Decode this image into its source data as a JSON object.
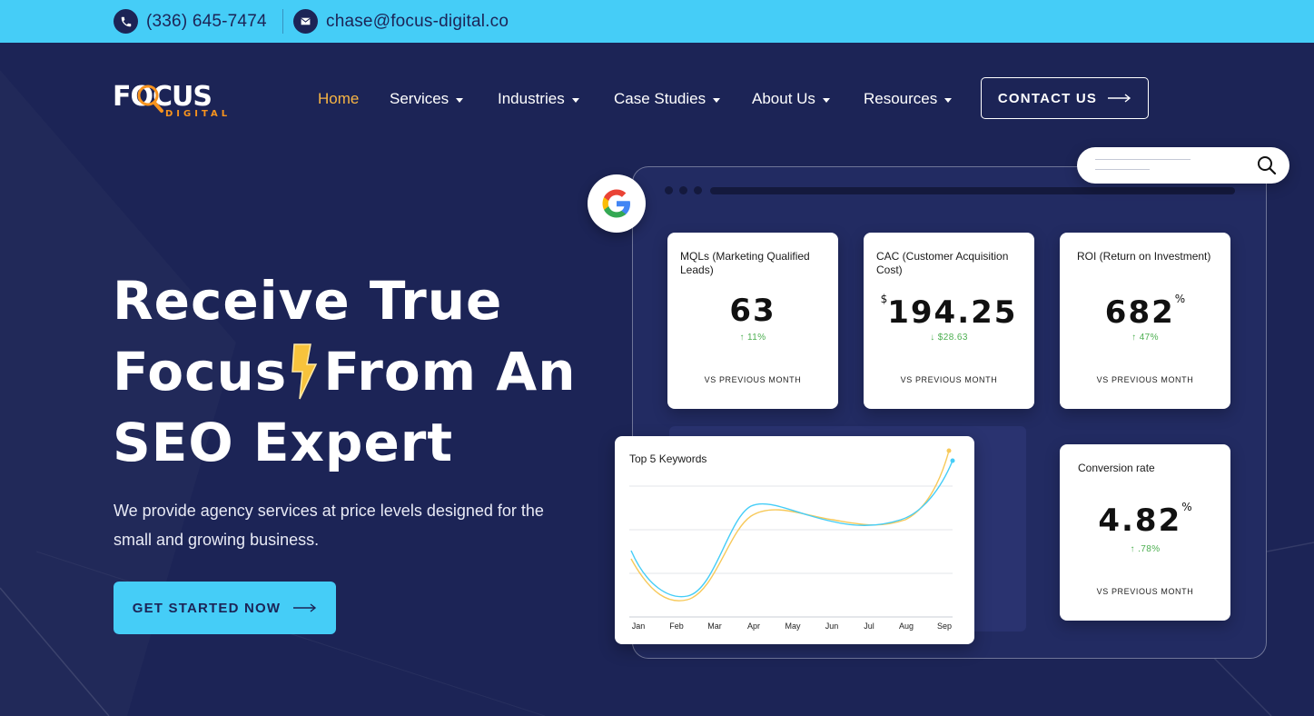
{
  "topbar": {
    "phone": "(336) 645-7474",
    "email": "chase@focus-digital.co",
    "phone_icon": "phone-icon",
    "email_icon": "mail-icon",
    "bg_color": "#45cdf7"
  },
  "brand": {
    "logo_word": "FOCUS",
    "logo_sub": "DIGITAL",
    "accent": "#f7931e"
  },
  "nav": {
    "items": [
      {
        "label": "Home",
        "active": true,
        "dropdown": false
      },
      {
        "label": "Services",
        "active": false,
        "dropdown": true
      },
      {
        "label": "Industries",
        "active": false,
        "dropdown": true
      },
      {
        "label": "Case Studies",
        "active": false,
        "dropdown": true
      },
      {
        "label": "About Us",
        "active": false,
        "dropdown": true
      },
      {
        "label": "Resources",
        "active": false,
        "dropdown": true
      }
    ],
    "contact_label": "CONTACT US",
    "active_color": "#f7b544"
  },
  "hero": {
    "line1": "Receive True",
    "line2a": "Focus",
    "line2b": "From An",
    "line3": "SEO Expert",
    "subtitle": "We provide agency services at price levels designed for the small and growing business.",
    "cta_label": "GET STARTED NOW",
    "bg_color": "#1c2456"
  },
  "dashboard": {
    "cards": [
      {
        "title": "MQLs (Marketing Qualified Leads)",
        "prefix": "",
        "value": "63",
        "suffix": "",
        "delta": "11%",
        "direction": "up",
        "footer": "VS PREVIOUS MONTH"
      },
      {
        "title": "CAC (Customer Acquisition Cost)",
        "prefix": "$",
        "value": "194.25",
        "suffix": "",
        "delta": "$28.63",
        "direction": "down",
        "footer": "VS PREVIOUS MONTH"
      },
      {
        "title": "ROI (Return on Investment)",
        "prefix": "",
        "value": "682",
        "suffix": "%",
        "delta": "47%",
        "direction": "up",
        "footer": "VS PREVIOUS MONTH"
      },
      {
        "title": "Conversion rate",
        "prefix": "",
        "value": "4.82",
        "suffix": "%",
        "delta": ".78%",
        "direction": "up",
        "footer": "VS PREVIOUS MONTH"
      }
    ],
    "keywords_chart": {
      "title": "Top 5 Keywords",
      "months": [
        "Jan",
        "Feb",
        "Mar",
        "Apr",
        "May",
        "Jun",
        "Jul",
        "Aug",
        "Sep"
      ],
      "series_colors": [
        "#45cdf7",
        "#f7c95a"
      ]
    }
  }
}
